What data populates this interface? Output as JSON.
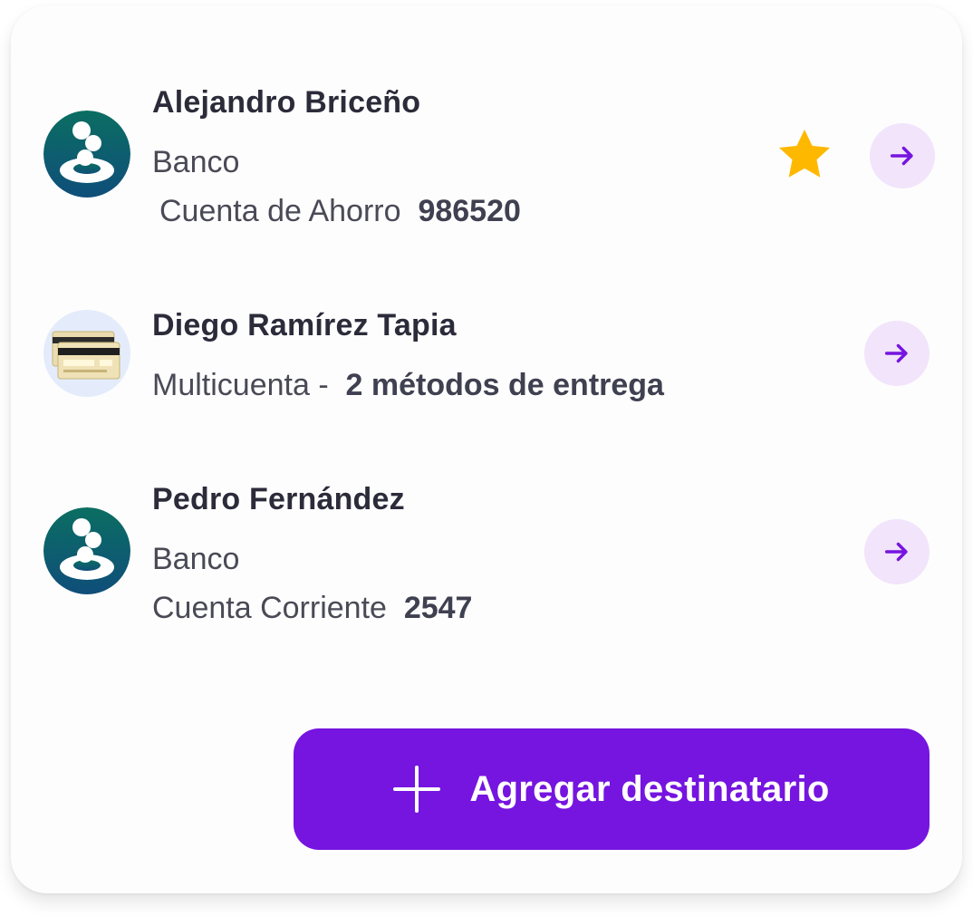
{
  "recipients": [
    {
      "name": "Alejandro Briceño",
      "line1": "Banco",
      "account_type": "Cuenta de Ahorro",
      "account_number": "986520",
      "favorite": true,
      "avatar_icon": "bank-logo-icon"
    },
    {
      "name": "Diego Ramírez Tapia",
      "line1_prefix": "Multicuenta -",
      "line1_bold": "2 métodos de entrega",
      "favorite": false,
      "avatar_icon": "cards-icon"
    },
    {
      "name": "Pedro Fernández",
      "line1": "Banco",
      "account_type": "Cuenta Corriente",
      "account_number": "2547",
      "favorite": false,
      "avatar_icon": "bank-logo-icon"
    }
  ],
  "add_button": {
    "label": "Agregar destinatario",
    "icon": "plus-icon"
  },
  "colors": {
    "accent": "#7614e0",
    "arrow_bg": "#f1e4fb",
    "star": "#ffb800",
    "bank_logo_top": "#0b6e62",
    "bank_logo_bottom": "#0f4e7a"
  }
}
